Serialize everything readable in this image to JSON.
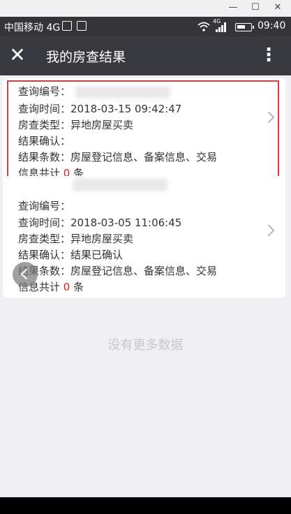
{
  "window_controls": {
    "minimize": "—",
    "maximize": "☐",
    "close": "✕"
  },
  "status_bar": {
    "carrier": "中国移动 4G",
    "network": "4G",
    "time": "09:40"
  },
  "header": {
    "close": "✕",
    "title": "我的房查结果",
    "more": "⋮"
  },
  "records": [
    {
      "id_label": "查询编号：",
      "time_label": "查询时间：",
      "time_value": "2018-03-15 09:42:47",
      "type_label": "房查类型：",
      "type_value": "异地房屋买卖",
      "confirm_label": "结果确认：",
      "confirm_value": "",
      "items_label": "结果条数：",
      "items_value": "房屋登记信息、备案信息、交易",
      "total_prefix": "信息共计",
      "total_count": "0",
      "total_suffix": "条"
    },
    {
      "id_label": "查询编号：",
      "time_label": "查询时间：",
      "time_value": "2018-03-05 11:06:45",
      "type_label": "房查类型：",
      "type_value": "异地房屋买卖",
      "confirm_label": "结果确认：",
      "confirm_value": "结果已确认",
      "items_label": "结果条数：",
      "items_value": "房屋登记信息、备案信息、交易",
      "total_prefix": "信息共计",
      "total_count": "0",
      "total_suffix": "条"
    }
  ],
  "footer": {
    "no_more": "没有更多数据"
  },
  "colors": {
    "header_bg": "#393a3f",
    "highlight": "#e03a3a",
    "count_red": "#e02020"
  }
}
